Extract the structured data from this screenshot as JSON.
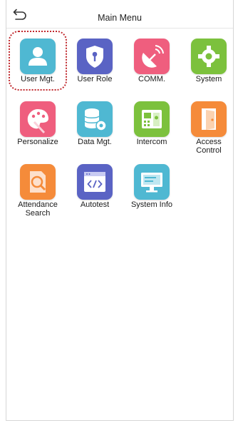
{
  "header": {
    "title": "Main Menu",
    "back_icon": "back-arrow-icon"
  },
  "menu": [
    {
      "label": "User Mgt.",
      "icon": "user-icon",
      "color": "#4fb8d2",
      "selected": true
    },
    {
      "label": "User Role",
      "icon": "shield-key-icon",
      "color": "#5a63c4"
    },
    {
      "label": "COMM.",
      "icon": "satellite-dish-icon",
      "color": "#ef5e7e"
    },
    {
      "label": "System",
      "icon": "gear-icon",
      "color": "#7cc13d"
    },
    {
      "label": "Personalize",
      "icon": "palette-icon",
      "color": "#ef5e7e"
    },
    {
      "label": "Data Mgt.",
      "icon": "database-gear-icon",
      "color": "#4fb8d2"
    },
    {
      "label": "Intercom",
      "icon": "intercom-panel-icon",
      "color": "#7cc13d"
    },
    {
      "label": "Access\nControl",
      "icon": "door-icon",
      "color": "#f58b3a"
    },
    {
      "label": "Attendance\nSearch",
      "icon": "search-document-icon",
      "color": "#f58b3a"
    },
    {
      "label": "Autotest",
      "icon": "code-window-icon",
      "color": "#5a63c4"
    },
    {
      "label": "System Info",
      "icon": "monitor-icon",
      "color": "#4fb8d2"
    }
  ]
}
